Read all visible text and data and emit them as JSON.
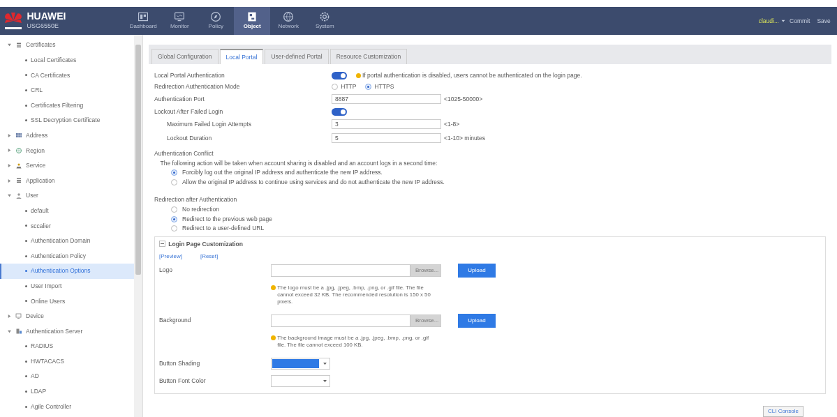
{
  "header": {
    "brand": "HUAWEI",
    "model": "USG6550E",
    "nav": [
      {
        "label": "Dashboard",
        "selected": false
      },
      {
        "label": "Monitor",
        "selected": false
      },
      {
        "label": "Policy",
        "selected": false
      },
      {
        "label": "Object",
        "selected": true
      },
      {
        "label": "Network",
        "selected": false
      },
      {
        "label": "System",
        "selected": false
      }
    ],
    "user": "claudi...",
    "commit": "Commit",
    "save": "Save"
  },
  "sidebar": {
    "items": [
      {
        "label": "Certificates",
        "expanded": true,
        "children": [
          {
            "label": "Local Certificates",
            "selected": false
          },
          {
            "label": "CA Certificates",
            "selected": false
          },
          {
            "label": "CRL",
            "selected": false
          },
          {
            "label": "Certificates Filtering",
            "selected": false
          },
          {
            "label": "SSL Decryption Certificate",
            "selected": false
          }
        ]
      },
      {
        "label": "Address",
        "expanded": false
      },
      {
        "label": "Region",
        "expanded": false
      },
      {
        "label": "Service",
        "expanded": false
      },
      {
        "label": "Application",
        "expanded": false
      },
      {
        "label": "User",
        "expanded": true,
        "children": [
          {
            "label": "default",
            "selected": false
          },
          {
            "label": "sccalier",
            "selected": false
          },
          {
            "label": "Authentication Domain",
            "selected": false
          },
          {
            "label": "Authentication Policy",
            "selected": false
          },
          {
            "label": "Authentication Options",
            "selected": true
          },
          {
            "label": "User Import",
            "selected": false
          },
          {
            "label": "Online Users",
            "selected": false
          }
        ]
      },
      {
        "label": "Device",
        "expanded": false
      },
      {
        "label": "Authentication Server",
        "expanded": true,
        "children": [
          {
            "label": "RADIUS",
            "selected": false
          },
          {
            "label": "HWTACACS",
            "selected": false
          },
          {
            "label": "AD",
            "selected": false
          },
          {
            "label": "LDAP",
            "selected": false
          },
          {
            "label": "Agile Controller",
            "selected": false
          }
        ]
      }
    ]
  },
  "tabs": [
    {
      "label": "Global Configuration",
      "selected": false
    },
    {
      "label": "Local Portal",
      "selected": true
    },
    {
      "label": "User-defined Portal",
      "selected": false
    },
    {
      "label": "Resource Customization",
      "selected": false
    }
  ],
  "form": {
    "portal_auth": {
      "label": "Local Portal Authentication",
      "on": true,
      "note": "If portal authentication is disabled, users cannot be authenticated on the login page."
    },
    "redirect_mode": {
      "label": "Redirection Authentication Mode",
      "options": [
        {
          "label": "HTTP",
          "selected": false
        },
        {
          "label": "HTTPS",
          "selected": true
        }
      ]
    },
    "auth_port": {
      "label": "Authentication Port",
      "value": "8887",
      "range": "<1025-50000>"
    },
    "lockout": {
      "label": "Lockout After Failed Login",
      "on": true
    },
    "max_attempts": {
      "label": "Maximum Failed Login Attempts",
      "value": "3",
      "range": "<1-8>"
    },
    "lockout_duration": {
      "label": "Lockout Duration",
      "value": "5",
      "range": "<1-10> minutes"
    },
    "conflict": {
      "label": "Authentication Conflict",
      "description": "The following action will be taken when account sharing is disabled and an account logs in a second time:",
      "options": [
        {
          "label": "Forcibly log out the original IP address and authenticate the new IP address.",
          "selected": true
        },
        {
          "label": "Allow the original IP address to continue using services and do not authenticate the new IP address.",
          "selected": false
        }
      ]
    },
    "redirect_after": {
      "label": "Redirection after Authentication",
      "options": [
        {
          "label": "No redirection",
          "selected": false
        },
        {
          "label": "Redirect to the previous web page",
          "selected": true
        },
        {
          "label": "Redirect to a user-defined URL",
          "selected": false
        }
      ]
    },
    "login_page": {
      "title": "Login Page Customization",
      "expanded": true,
      "links": [
        "[Preview]",
        "[Reset]"
      ],
      "uploads": [
        {
          "label": "Logo",
          "browse": "Browse...",
          "upload": "Upload",
          "hint": "The logo must be a .jpg, .jpeg, .bmp, .png, or .gif file. The file cannot exceed 32 KB. The recommended resolution is 150 x 50 pixels."
        },
        {
          "label": "Background",
          "browse": "Browse...",
          "upload": "Upload",
          "hint": "The background image must be a .jpg, .jpeg, .bmp, .png, or .gif file. The file cannot exceed 100 KB."
        }
      ],
      "pickers": [
        {
          "label": "Button Shading",
          "color": "#2f7ae5"
        },
        {
          "label": "Button Font Color"
        }
      ]
    }
  },
  "cli_console": "CLI Console"
}
